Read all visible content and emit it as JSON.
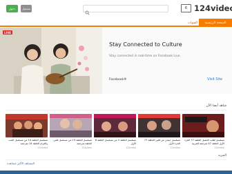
{
  "header": {
    "btn_green": "دخول",
    "btn_gray": "تسجيل",
    "logo_box": "6",
    "logo_text": "124video"
  },
  "nav": {
    "home": "الصفحة الرئيسية",
    "channels": "القنوات"
  },
  "banner": {
    "live": "LIVE",
    "title": "Stay Connected to Culture",
    "desc": "Stay connected in real-time on Facebook Live.",
    "brand": "Facebook®",
    "visit": "Visit Site"
  },
  "sections": {
    "latest": "شاهد أيضا الآن",
    "most": "المشاهد الأكثر مشاهدة",
    "more": "المزيد"
  },
  "cards": [
    {
      "title": "مسلسل الحلقة 14 من مسلسل الحب والغرام الحلقة 14 مترجمة",
      "meta": "124video"
    },
    {
      "title": "مسلسل الحلقة 13 من مسلسل قلبي الحلقة مترجمة",
      "meta": "124video"
    },
    {
      "title": "مسلسل الحلقة 2 من مسلسل الحلقة 6 الأول",
      "meta": "124video"
    },
    {
      "title": "مسلسل جيجي من قلبي الحلقة 77 الجزء الأول",
      "meta": "124video"
    },
    {
      "title": "مسلسل لقلب الجميل الحلقة 77 الجزء الأول الحلقة 47 مترجمة للعربية",
      "meta": "124video"
    }
  ],
  "colors": {
    "accent": "#f57c00",
    "live": "#e0292c",
    "link": "#1a73e8"
  }
}
